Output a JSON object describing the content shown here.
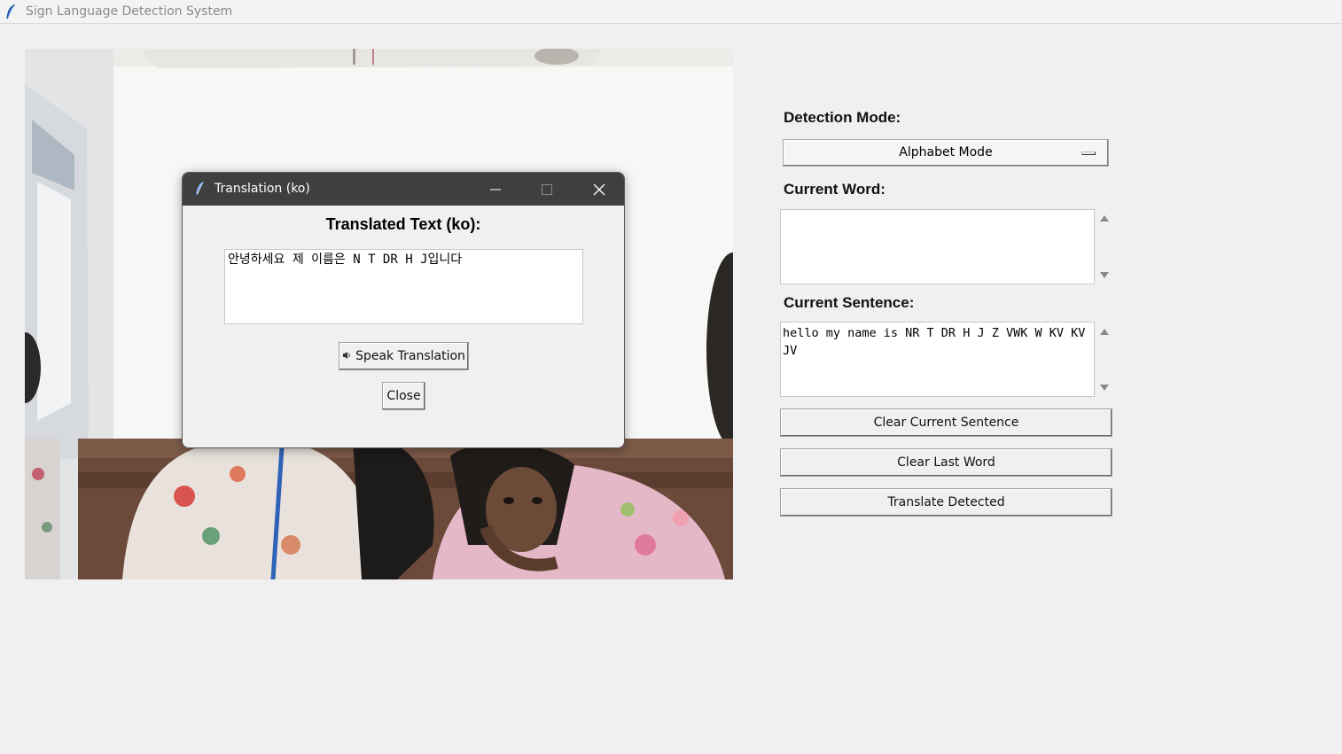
{
  "window": {
    "title": "Sign Language Detection System"
  },
  "panel": {
    "detection_mode_label": "Detection Mode:",
    "detection_mode_value": "Alphabet Mode",
    "current_word_label": "Current Word:",
    "current_word_value": "",
    "current_sentence_label": "Current Sentence:",
    "current_sentence_value": "hello my name is NR T DR H J Z VWK W KV KV JV",
    "clear_sentence_button": "Clear Current Sentence",
    "clear_word_button": "Clear Last Word",
    "translate_button": "Translate Detected"
  },
  "dialog": {
    "title": "Translation (ko)",
    "heading": "Translated Text (ko):",
    "translated_text": "안녕하세요 제 이름은 N T DR H J입니다",
    "speak_button": "Speak Translation",
    "close_button": "Close"
  },
  "icons": {
    "app": "feather-icon",
    "speak": "speaker-icon"
  },
  "colors": {
    "dialog_titlebar": "#3f3f3f",
    "background": "#f0f0f0"
  }
}
